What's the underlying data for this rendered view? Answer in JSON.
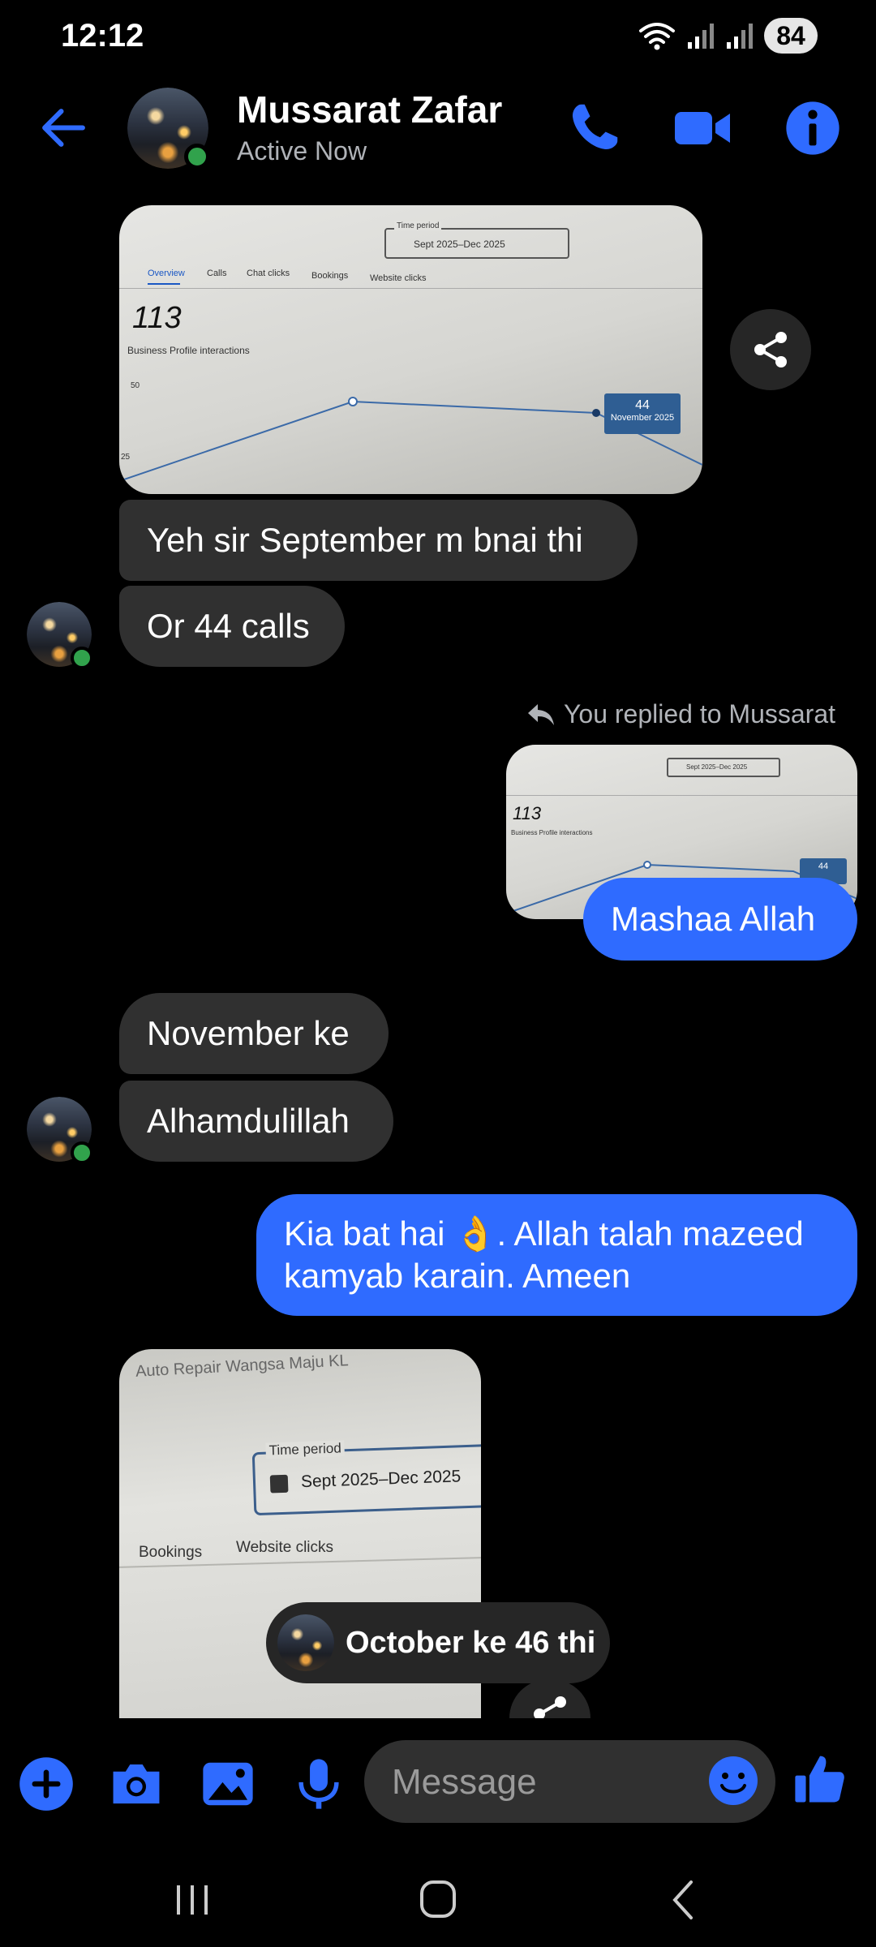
{
  "status_bar": {
    "time": "12:12",
    "battery": "84"
  },
  "header": {
    "contact_name": "Mussarat Zafar",
    "contact_status": "Active Now"
  },
  "messages": {
    "photo1": {
      "time_period_label": "Time period",
      "time_period_value": "Sept 2025–Dec 2025",
      "tabs": [
        "Overview",
        "Calls",
        "Chat clicks",
        "Bookings",
        "Website clicks"
      ],
      "big_number": "113",
      "caption": "Business Profile interactions",
      "axis_50": "50",
      "axis_25": "25",
      "tooltip_value": "44",
      "tooltip_month": "November 2025"
    },
    "in1": "Yeh sir September m bnai thi",
    "in2": "Or 44 calls",
    "reply_note": "You replied to Mussarat",
    "reply_photo": {
      "time_period_value": "Sept 2025–Dec 2025",
      "big_number": "113",
      "caption": "Business Profile interactions",
      "tooltip_value": "44"
    },
    "out1": "Mashaa Allah",
    "in3": "November ke",
    "in4": "Alhamdulillah",
    "out2_line1": "Kia bat hai 👌. Allah talah mazeed",
    "out2_line2": "kamyab karain. Ameen",
    "photo2": {
      "header_text": "Auto Repair Wangsa Maju KL",
      "time_period_label": "Time period",
      "time_period_value": "Sept 2025–Dec 2025",
      "tab1": "Bookings",
      "tab2": "Website clicks"
    },
    "toast": "October ke 46 thi"
  },
  "composer": {
    "placeholder": "Message"
  },
  "colors": {
    "accent": "#2f6bff",
    "online": "#31a24c",
    "incoming_bubble": "#303030"
  },
  "icons": [
    "wifi-icon",
    "signal-icon",
    "back-arrow-icon",
    "phone-icon",
    "video-icon",
    "info-icon",
    "share-icon",
    "reply-icon",
    "plus-icon",
    "camera-icon",
    "gallery-icon",
    "mic-icon",
    "emoji-icon",
    "thumbs-up-icon",
    "recents-icon",
    "home-icon",
    "nav-back-icon"
  ]
}
